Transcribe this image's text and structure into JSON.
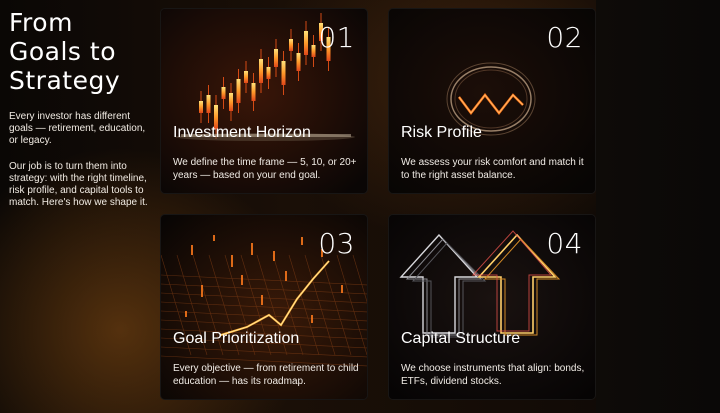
{
  "hero": {
    "headline_lines": [
      "From",
      "Goals to",
      "Strategy"
    ],
    "paragraph_1": "Every investor has different goals — retirement, education, or legacy.",
    "paragraph_2": "Our job is to turn them into strategy: with the right timeline, risk profile, and capital tools to match. Here's how we shape it."
  },
  "cards": [
    {
      "number": "01",
      "title": "Investment Horizon",
      "description": "We define the time frame — 5, 10, or 20+ years — based on your end goal.",
      "icon": "candlestick-chart-icon"
    },
    {
      "number": "02",
      "title": "Risk Profile",
      "description": "We assess your risk comfort and match it to the right asset balance.",
      "icon": "risk-wave-icon"
    },
    {
      "number": "03",
      "title": "Goal Prioritization",
      "description": "Every objective — from retirement to child education — has its roadmap.",
      "icon": "rising-line-grid-icon"
    },
    {
      "number": "04",
      "title": "Capital Structure",
      "description": "We choose instruments that align: bonds, ETFs, dividend stocks.",
      "icon": "up-arrows-icon"
    }
  ],
  "colors": {
    "accent_orange": "#ff8a1c",
    "accent_red": "#ff3a1a",
    "glow_yellow": "#ffd36a",
    "background": "#0b0806"
  }
}
